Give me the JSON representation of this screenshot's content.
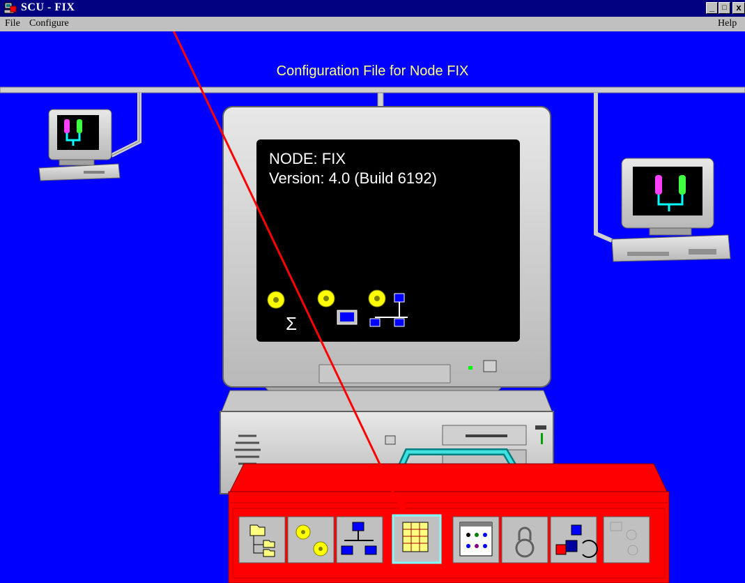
{
  "window": {
    "title": "SCU - FIX",
    "controls": [
      "_",
      "□",
      "x"
    ]
  },
  "menubar": {
    "file": "File",
    "configure": "Configure",
    "help": "Help"
  },
  "main": {
    "caption": "Configuration File for Node FIX",
    "monitor_screen": {
      "node_line": "NODE: FIX",
      "version_line": "Version:  4.0 (Build 6192)"
    }
  },
  "toolbox": {
    "tools": [
      {
        "icon": "folder-tree-icon"
      },
      {
        "icon": "sql-database-icon"
      },
      {
        "icon": "network-icon"
      },
      {
        "icon": "alarm-grid-icon",
        "selected": true
      },
      {
        "icon": "scada-config-icon"
      },
      {
        "icon": "security-lock-icon"
      },
      {
        "icon": "auto-startup-icon"
      },
      {
        "icon": "disabled-tasks-icon",
        "disabled": true
      }
    ]
  },
  "colors": {
    "titlebar": "#000080",
    "background": "#0000ff",
    "caption": "#ffff80",
    "toolbox": "#ff0000",
    "annotation_arrow": "#ff0000",
    "selected_tool_border": "#80ffff"
  }
}
